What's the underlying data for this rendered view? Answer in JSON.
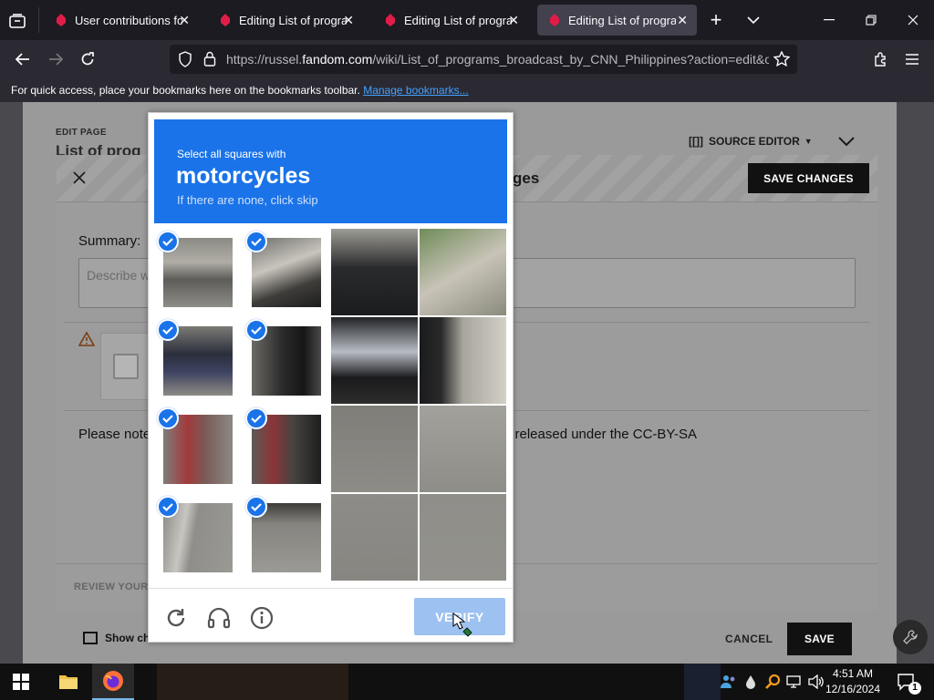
{
  "browser": {
    "tabs": [
      {
        "title": "User contributions for"
      },
      {
        "title": "Editing List of program"
      },
      {
        "title": "Editing List of program"
      },
      {
        "title": "Editing List of program"
      }
    ],
    "url_prefix": "https://russel.",
    "url_host": "fandom.com",
    "url_path": "/wiki/List_of_programs_broadcast_by_CNN_Philippines?action=edit&ol",
    "bookmarks_message": "For quick access, place your bookmarks here on the bookmarks toolbar.",
    "bookmarks_link": "Manage bookmarks..."
  },
  "editor": {
    "edit_page_label": "EDIT PAGE",
    "page_title": "List of prog",
    "source_editor_label": "SOURCE EDITOR",
    "save_changes_header": "ges",
    "save_changes_button": "SAVE CHANGES",
    "summary_label": "Summary:",
    "summary_placeholder": "Describe w",
    "please_note": "Please note",
    "license_text": "e released under the CC-BY-SA",
    "review_label": "REVIEW YOUR",
    "show_changes_label": "Show ch",
    "cancel_label": "CANCEL",
    "save_label": "SAVE"
  },
  "captcha": {
    "instruction": "Select all squares with",
    "target": "motorcycles",
    "hint": "If there are none, click skip",
    "verify_label": "VERIFY",
    "selected_tiles": 8,
    "grid_tiles": 8
  },
  "taskbar": {
    "time": "4:51 AM",
    "date": "12/16/2024",
    "notification_count": "1"
  },
  "colors": {
    "captcha_blue": "#1a73e8",
    "verify_disabled": "#9dc1f1",
    "tab_active": "#42414d"
  }
}
